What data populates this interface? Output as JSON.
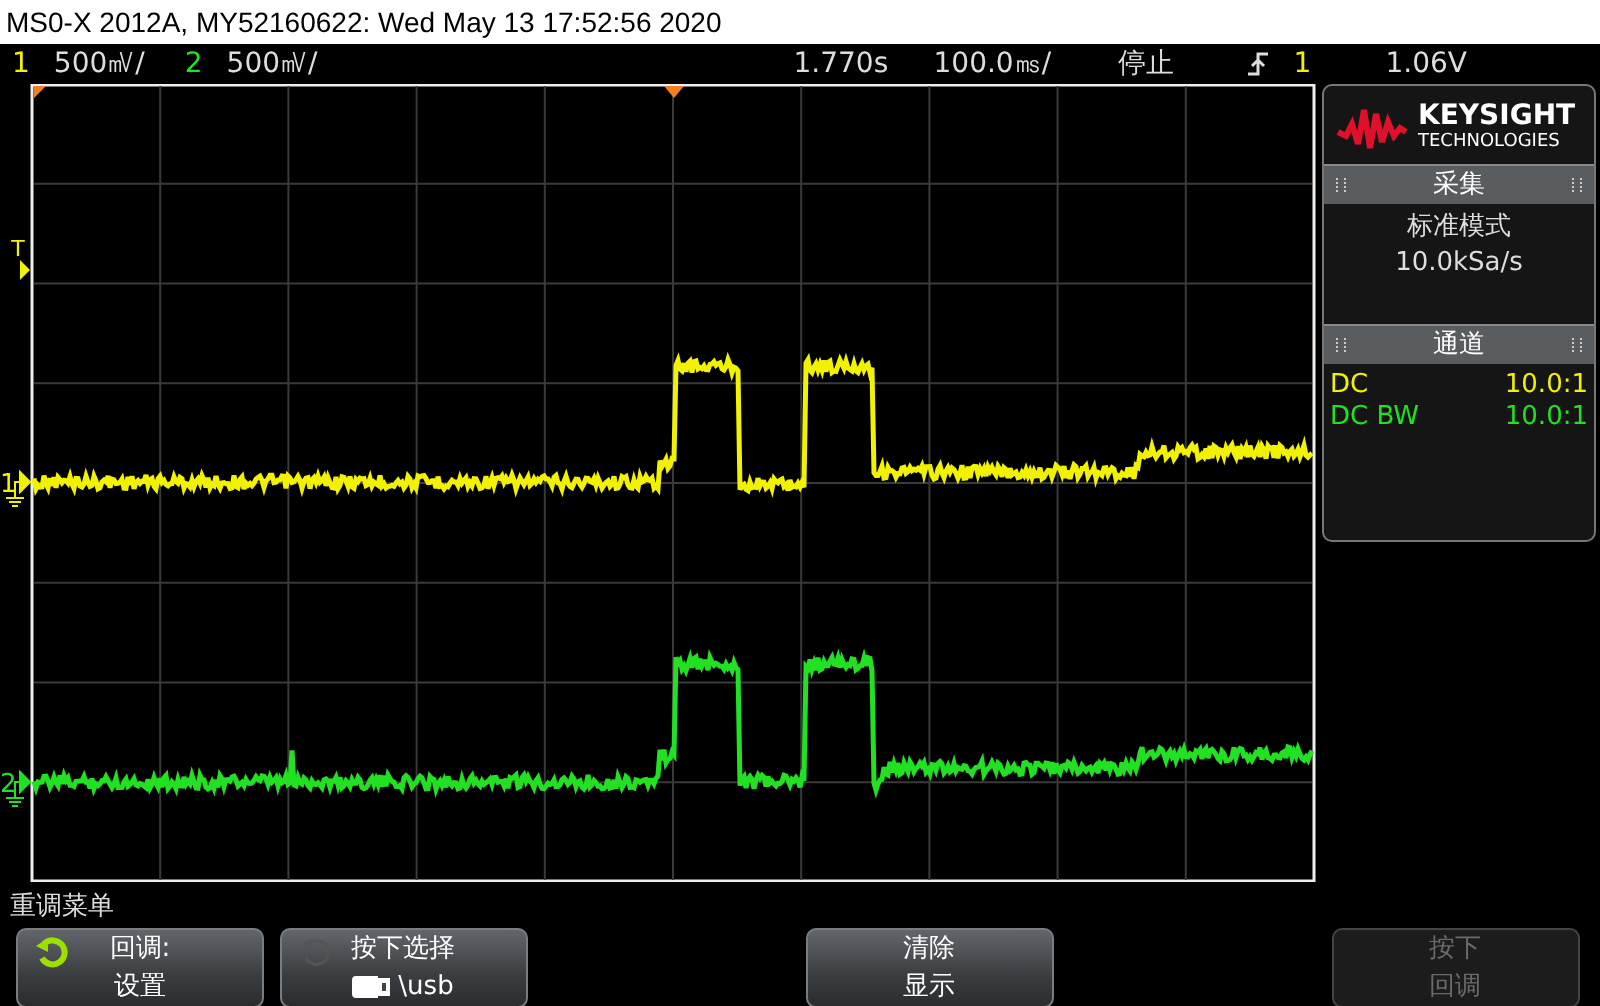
{
  "title": "MS0-X 2012A, MY52160622: Wed May 13 17:52:56 2020",
  "status_bar": {
    "channels": [
      {
        "number": "1",
        "scale": "500㎷/",
        "color": "#f2f200"
      },
      {
        "number": "2",
        "scale": "500㎷/",
        "color": "#22e022"
      }
    ],
    "time_position": "1.770s",
    "time_scale": "100.0㎳/",
    "run_state": "停止",
    "trigger": {
      "source": "1",
      "color": "#f2f200",
      "level": "1.06V"
    }
  },
  "graticule": {
    "markers": [
      {
        "kind": "trigger-level",
        "label": "T",
        "color": "#f2f200"
      },
      {
        "kind": "channel",
        "label": "1",
        "color": "#f2f200"
      },
      {
        "kind": "channel",
        "label": "2",
        "color": "#22e022"
      }
    ]
  },
  "side_panel": {
    "logo": {
      "name": "KEYSIGHT",
      "subtitle": "TECHNOLOGIES"
    },
    "sections": [
      {
        "kind": "text",
        "title": "采集",
        "lines": [
          "标准模式",
          "10.0kSa/s"
        ]
      },
      {
        "kind": "table",
        "title": "通道",
        "rows": [
          {
            "label": "DC",
            "value": "10.0:1",
            "color": "#f2f200"
          },
          {
            "label": "DC BW",
            "value": "10.0:1",
            "color": "#22e022"
          }
        ]
      }
    ]
  },
  "menu_title": "重调菜单",
  "softkeys": [
    {
      "kind": "undo-button",
      "title": "回调:",
      "value": "设置",
      "undo_available": true,
      "disabled": false
    },
    {
      "kind": "path-button",
      "title": "按下选择",
      "value": "\\usb",
      "undo_available": false,
      "disabled": false
    },
    {
      "kind": "empty"
    },
    {
      "kind": "plain-button",
      "title": "清除",
      "value": "显示",
      "disabled": false
    },
    {
      "kind": "empty"
    },
    {
      "kind": "plain-button",
      "title": "按下",
      "value": "回调",
      "disabled": true
    }
  ]
}
